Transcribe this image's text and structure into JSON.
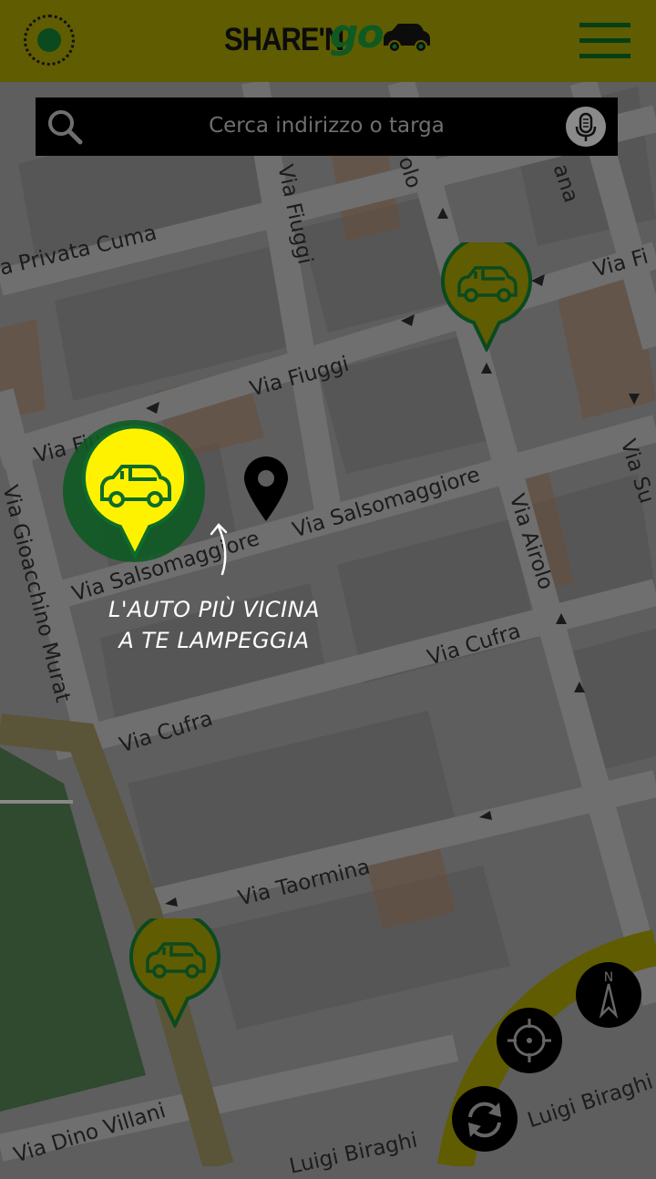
{
  "header": {
    "logo_share": "SHARE'N",
    "logo_go": "go",
    "status_icon": "status-dot-icon",
    "menu_icon": "hamburger-menu-icon"
  },
  "search": {
    "placeholder": "Cerca indirizzo o targa",
    "search_icon": "search-icon",
    "voice_icon": "microphone-icon"
  },
  "map": {
    "streets": [
      "a Privata Cuma",
      "Via Fiuggi",
      "Via Fiuggi",
      "Via Fiuggi",
      "Via Salsomaggiore",
      "Via Salsomaggiore",
      "Via Gioacchino Murat",
      "Via Airolo",
      "Via Cufra",
      "Via Cufra",
      "Via Taormina",
      "Via Dino Villani",
      "Luigi Biraghi",
      "Luigi Biraghi",
      "olo",
      "ana",
      "Via Fi",
      "Via Su"
    ],
    "hint_line1": "L'AUTO PIÙ VICINA",
    "hint_line2": "A TE LAMPEGGIA"
  },
  "controls": {
    "compass_label": "N",
    "compass_icon": "compass-icon",
    "locate_icon": "locate-crosshair-icon",
    "refresh_icon": "refresh-icon"
  },
  "colors": {
    "brand_yellow": "#fff200",
    "brand_green": "#0f6b2a",
    "dim_yellow": "#605c01"
  }
}
